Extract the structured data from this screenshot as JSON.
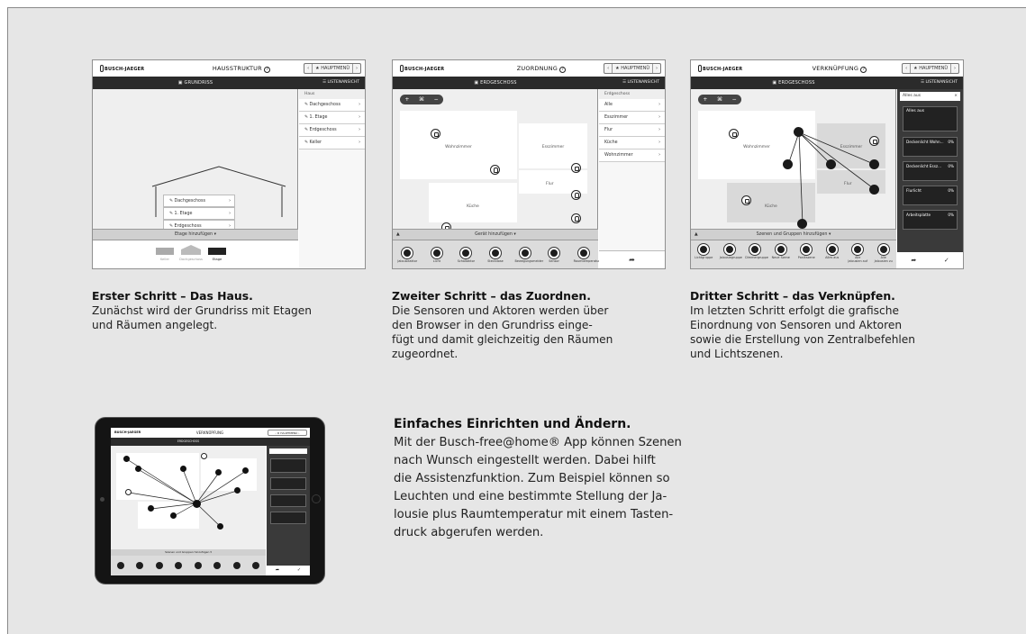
{
  "brand": "BUSCH-JAEGER",
  "nav": {
    "back": "‹",
    "home": "★ HAUPTMENÜ",
    "fwd": "›"
  },
  "shot1": {
    "title": "HAUSSTRUKTUR",
    "bar": "GRUNDRISS",
    "bar_list": "LISTENANSICHT",
    "side_header": "Haus",
    "floors": [
      "Dachgeschoss",
      "1. Etage",
      "Erdgeschoss",
      "Keller"
    ],
    "add_floor": "Etage hinzufügen ▾",
    "bottom": [
      "Keller",
      "Dachgeschoss",
      "Etage"
    ]
  },
  "shot2": {
    "title": "ZUORDNUNG",
    "bar": "ERDGESCHOSS",
    "bar_list": "LISTENANSICHT",
    "side_header": "Erdgeschoss",
    "rooms_list": [
      "Alle",
      "Esszimmer",
      "Flur",
      "Küche",
      "Wohnzimmer"
    ],
    "rooms": [
      "Wohnzimmer",
      "Esszimmer",
      "Flur",
      "Küche"
    ],
    "add_device": "Gerät hinzufügen ▾",
    "devices": [
      "Jalousieaktor",
      "Licht",
      "Schaltaktor",
      "Steckdose",
      "Bewegungsmelder",
      "Sensor",
      "Raumtemperatur"
    ]
  },
  "shot3": {
    "title": "VERKNÜPFUNG",
    "bar": "ERDGESCHOSS",
    "bar_list": "LISTENANSICHT",
    "side_header": "Alles aus",
    "rooms": [
      "Wohnzimmer",
      "Esszimmer",
      "Flur",
      "Küche"
    ],
    "tiles": [
      "Alles aus",
      "Deckenlicht Wohn...",
      "Deckenlicht Essz...",
      "Flurlicht",
      "Arbeitsplatte"
    ],
    "tile_value": "0%",
    "add_scene": "Szenen und Gruppen hinzufügen ▾",
    "devices": [
      "Lichtgruppe",
      "Jalousiegruppe",
      "Dimmergruppe",
      "Neue Szene",
      "Panikszene",
      "Alles aus",
      "Alle Jalousien auf",
      "Alle Jalousien zu"
    ]
  },
  "tablet": {
    "title": "VERKNÜPFUNG",
    "bar": "ERDGESCHOSS",
    "add_scene": "Szenen und Gruppen hinzufügen ▾"
  },
  "captions": [
    {
      "heading": "Erster Schritt – Das Haus.",
      "lines": [
        "Zunächst wird der Grundriss mit Etagen",
        "und Räumen angelegt."
      ]
    },
    {
      "heading": "Zweiter Schritt – das Zuordnen.",
      "lines": [
        "Die Sensoren und Aktoren werden über",
        "den Browser in den Grundriss einge-",
        "fügt und damit gleichzeitig den Räumen",
        "zugeordnet."
      ]
    },
    {
      "heading": "Dritter Schritt – das Verknüpfen.",
      "lines": [
        "Im letzten Schritt erfolgt die grafische",
        "Einordnung von Sensoren und Aktoren",
        "sowie die Erstellung von Zentralbefehlen",
        "und Lichtszenen."
      ]
    }
  ],
  "feature": {
    "heading": "Einfaches Einrichten und Ändern.",
    "lines": [
      "Mit der Busch-free@home® App können Szenen",
      "nach Wunsch eingestellt werden. Dabei hilft",
      "die Assistenzfunktion. Zum Beispiel können so",
      "Leuchten und eine bestimmte Stellung der Ja-",
      "lousie plus Raumtemperatur mit einem Tasten-",
      "druck abgerufen werden."
    ]
  }
}
